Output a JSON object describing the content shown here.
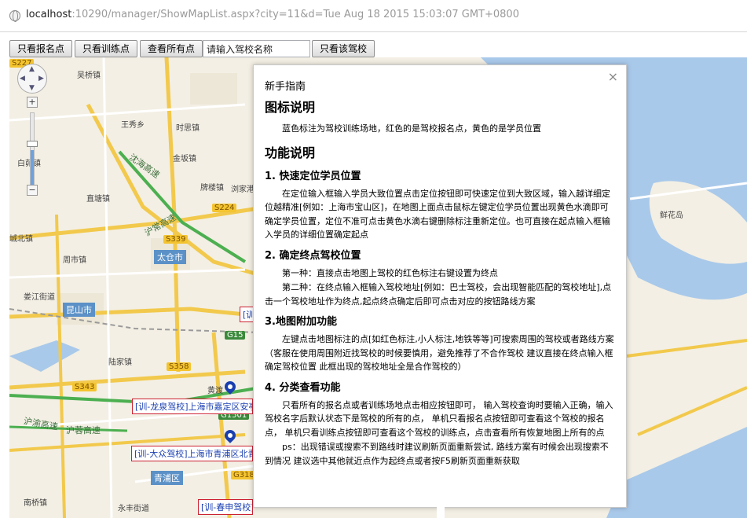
{
  "browser": {
    "url_host": "localhost",
    "url_rest": ":10290/manager/ShowMapList.aspx?city=11&d=Tue Aug 18 2015 15:03:07 GMT+0800"
  },
  "toolbar": {
    "btn_registration": "只看报名点",
    "btn_training": "只看训练点",
    "btn_all": "查看所有点",
    "search_value": "请输入驾校名称",
    "btn_this_school": "只看该驾校"
  },
  "map": {
    "places": [
      "吴桥镇",
      "王秀乡",
      "时思镇",
      "白茆镇",
      "金坂镇",
      "直塘镇",
      "牌楼镇",
      "浏家港镇",
      "城北镇",
      "周市镇",
      "娄江街道",
      "陆家镇",
      "黄渡",
      "南桥镇",
      "鲜花岛",
      "永丰街道"
    ],
    "districts": [
      "太仓市",
      "昆山市",
      "青浦区"
    ],
    "roads": [
      "S227",
      "S339",
      "S224",
      "S343",
      "S358",
      "G318",
      "G15",
      "G1501"
    ],
    "road_texts": [
      "沈海高速",
      "沪常高速",
      "沪渝高速",
      "沪蓉高速"
    ],
    "labels": [
      "[训-龙泉驾校]上海市嘉定区安亭",
      "[训-大众驾校]上海市青浦区北青",
      "[训-春申驾校]上",
      "[训"
    ],
    "zoom_in": "+",
    "zoom_out": "−"
  },
  "panel": {
    "close": "×",
    "guide_title": "新手指南",
    "icon_heading": "图标说明",
    "icon_text": "蓝色标注为驾校训练场地，红色的是驾校报名点，黄色的是学员位置",
    "func_heading": "功能说明",
    "s1_title": "1. 快速定位学员位置",
    "s1_text": "在定位输入框输入学员大致位置点击定位按钮即可快速定位到大致区域，输入越详细定位越精准[例如：上海市宝山区]，在地图上面点击鼠标左键定位学员位置出现黄色水滴即可确定学员位置，定位不准可点击黄色水滴右键删除标注重新定位。也可直接在起点输入框输入学员的详细位置确定起点",
    "s2_title": "2. 确定终点驾校位置",
    "s2_text1": "第一种：直接点击地图上驾校的红色标注右键设置为终点",
    "s2_text2": "第二种：在终点输入框输入驾校地址[例如：巴士驾校，会出现智能匹配的驾校地址],点击一个驾校地址作为终点,起点终点确定后即可点击对应的按钮路线方案",
    "s3_title": "3.地图附加功能",
    "s3_text": "左键点击地图标注的点[如红色标注,小人标注,地铁等等]可搜索周围的驾校或者路线方案（客服在使用周围附近找驾校的时候要慎用，避免推荐了不合作驾校 建议直接在终点输入框确定驾校位置 此框出现的驾校地址全是合作驾校的）",
    "s4_title": "4. 分类查看功能",
    "s4_text1": "只看所有的报名点或者训练场地点击相应按钮即可， 输入驾校查询时要输入正确，输入驾校名字后默认状态下是驾校的所有的点， 单机只看报名点按钮即可查看这个驾校的报名点， 单机只看训练点按钮即可查看这个驾校的训练点，点击查看所有恢复地图上所有的点",
    "s4_text2": "ps：出现错误或搜索不到路线时建议刷新页面重新尝试, 路线方案有时候会出现搜索不到情况 建议选中其他就近点作为起终点或者按F5刷新页面重新获取"
  }
}
